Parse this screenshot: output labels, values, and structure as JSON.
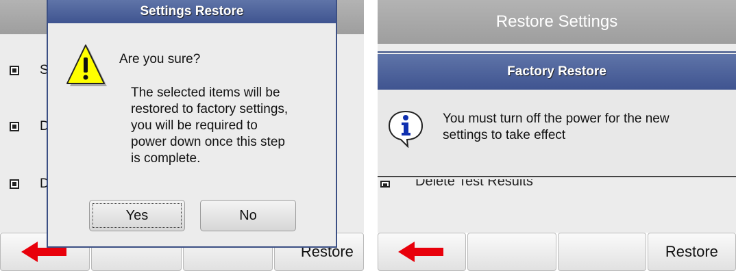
{
  "left": {
    "title": "",
    "dialog": {
      "title": "Settings Restore",
      "question": "Are you sure?",
      "message_lines": [
        "The selected items will be",
        "restored to factory settings,",
        "you will be required to",
        "power down once this step",
        "is complete."
      ],
      "yes_label": "Yes",
      "no_label": "No"
    },
    "rows": [
      {
        "fragment": "S"
      },
      {
        "fragment": "D"
      },
      {
        "fragment": "D"
      }
    ],
    "softkeys": {
      "key4_label": "Restore"
    }
  },
  "right": {
    "title": "Restore Settings",
    "dialog": {
      "title": "Factory Restore",
      "message_lines": [
        "You must turn off the power for the new",
        "settings to take effect"
      ]
    },
    "partial_row_label": "Delete Test Results",
    "softkeys": {
      "key4_label": "Restore"
    }
  },
  "colors": {
    "dialog_title_bg": "#3f5490",
    "back_arrow": "#e8000b",
    "warning_yellow": "#ffff00",
    "info_blue": "#1030b0"
  },
  "icons": {
    "warning": "warning-icon",
    "info": "info-icon",
    "back": "back-arrow-icon"
  }
}
